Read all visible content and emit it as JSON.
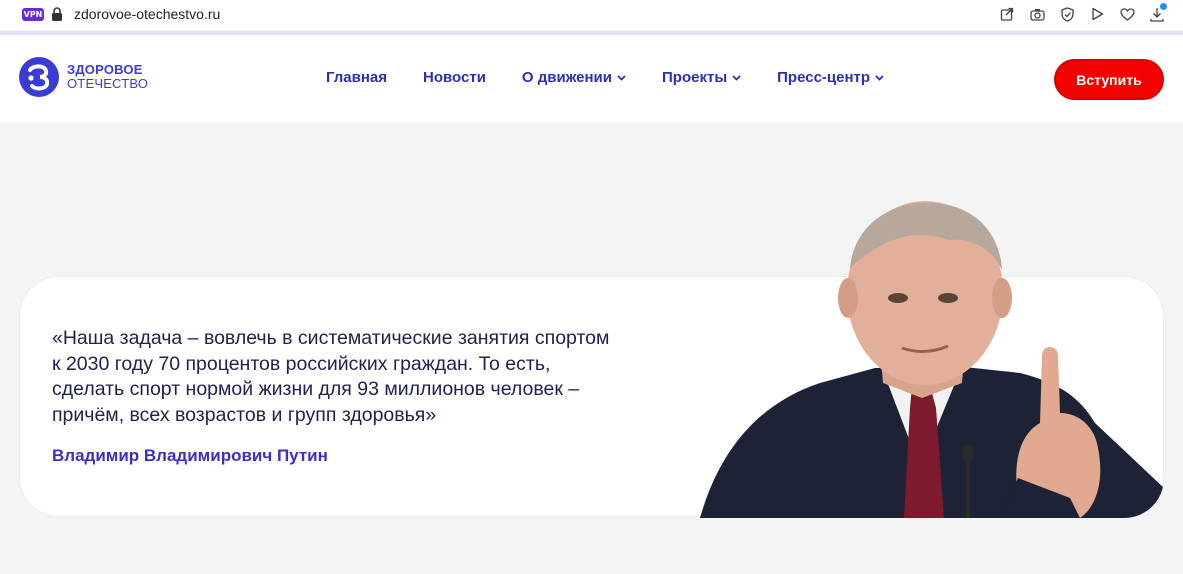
{
  "browser": {
    "vpn_label": "VPN",
    "url": "zdorovoe-otechestvo.ru",
    "icons": [
      "share-icon",
      "camera-icon",
      "shield-icon",
      "play-icon",
      "heart-icon",
      "download-icon"
    ]
  },
  "header": {
    "logo": {
      "line1": "ЗДОРОВОЕ",
      "line2": "ОТЕЧЕСТВО"
    },
    "nav": [
      {
        "label": "Главная",
        "has_dropdown": false
      },
      {
        "label": "Новости",
        "has_dropdown": false
      },
      {
        "label": "О движении",
        "has_dropdown": true
      },
      {
        "label": "Проекты",
        "has_dropdown": true
      },
      {
        "label": "Пресс-центр",
        "has_dropdown": true
      }
    ],
    "join_label": "Вступить"
  },
  "quote": {
    "lines": [
      "«Наша задача – вовлечь в систематические занятия спортом",
      "к 2030 году 70 процентов российских граждан. То есть,",
      "сделать спорт нормой жизни для 93 миллионов человек –",
      "причём, всех возрастов и групп здоровья»"
    ],
    "author": "Владимир Владимирович Путин"
  },
  "colors": {
    "brand": "#3b3cd6",
    "nav": "#2d2fb8",
    "cta": "#f50000",
    "background": "#f4f4f5"
  }
}
